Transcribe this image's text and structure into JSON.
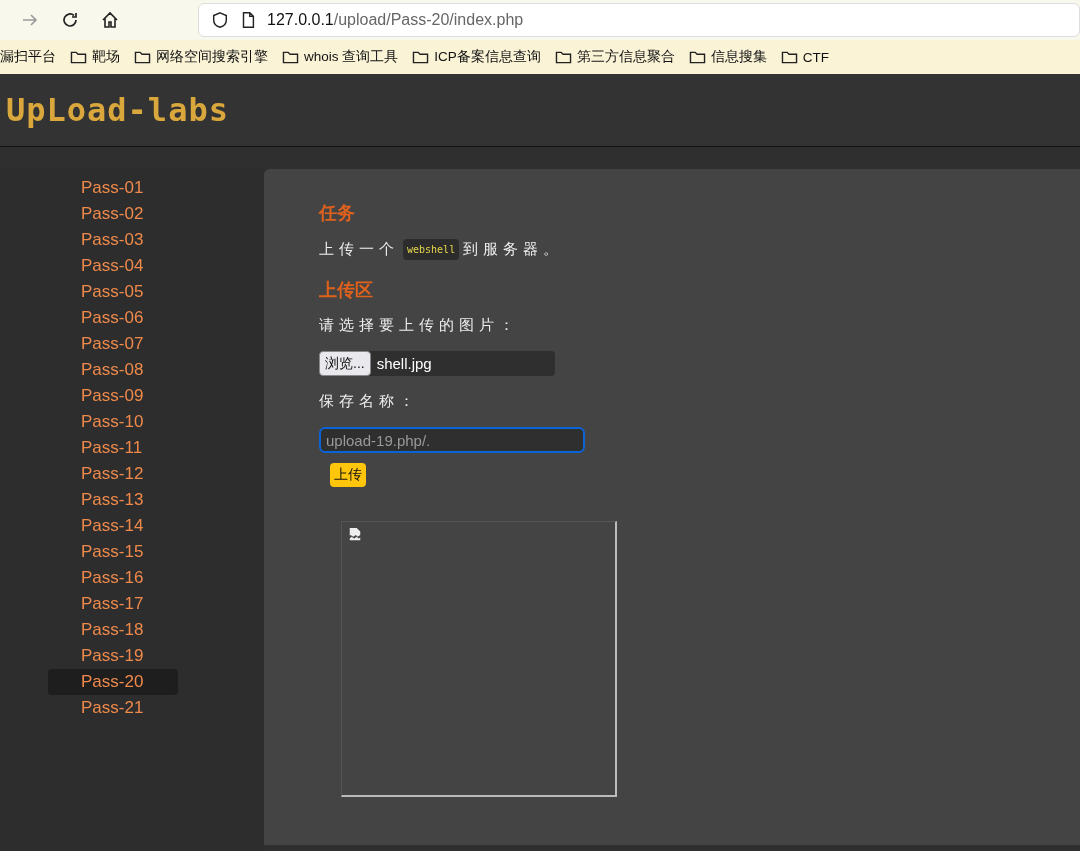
{
  "browser": {
    "url_host": "127.0.0.1",
    "url_path": "/upload/Pass-20/index.php",
    "bookmarks": [
      {
        "label": "漏扫平台",
        "folder": false
      },
      {
        "label": "靶场",
        "folder": true
      },
      {
        "label": "网络空间搜索引擎",
        "folder": true
      },
      {
        "label": "whois 查询工具",
        "folder": true
      },
      {
        "label": "ICP备案信息查询",
        "folder": true
      },
      {
        "label": "第三方信息聚合",
        "folder": true
      },
      {
        "label": "信息搜集",
        "folder": true
      },
      {
        "label": "CTF",
        "folder": true
      }
    ]
  },
  "logo": "UpLoad-labs",
  "sidebar": {
    "items": [
      {
        "label": "Pass-01",
        "selected": false
      },
      {
        "label": "Pass-02",
        "selected": false
      },
      {
        "label": "Pass-03",
        "selected": false
      },
      {
        "label": "Pass-04",
        "selected": false
      },
      {
        "label": "Pass-05",
        "selected": false
      },
      {
        "label": "Pass-06",
        "selected": false
      },
      {
        "label": "Pass-07",
        "selected": false
      },
      {
        "label": "Pass-08",
        "selected": false
      },
      {
        "label": "Pass-09",
        "selected": false
      },
      {
        "label": "Pass-10",
        "selected": false
      },
      {
        "label": "Pass-11",
        "selected": false
      },
      {
        "label": "Pass-12",
        "selected": false
      },
      {
        "label": "Pass-13",
        "selected": false
      },
      {
        "label": "Pass-14",
        "selected": false
      },
      {
        "label": "Pass-15",
        "selected": false
      },
      {
        "label": "Pass-16",
        "selected": false
      },
      {
        "label": "Pass-17",
        "selected": false
      },
      {
        "label": "Pass-18",
        "selected": false
      },
      {
        "label": "Pass-19",
        "selected": false
      },
      {
        "label": "Pass-20",
        "selected": true
      },
      {
        "label": "Pass-21",
        "selected": false
      }
    ]
  },
  "task": {
    "heading": "任务",
    "before": "上传一个",
    "code": "webshell",
    "after": "到服务器。"
  },
  "upload": {
    "heading": "上传区",
    "file_label": "请选择要上传的图片：",
    "browse_button": "浏览...",
    "file_name": "shell.jpg",
    "save_label": "保存名称：",
    "save_value": "upload-19.php/.",
    "submit": "上传"
  }
}
